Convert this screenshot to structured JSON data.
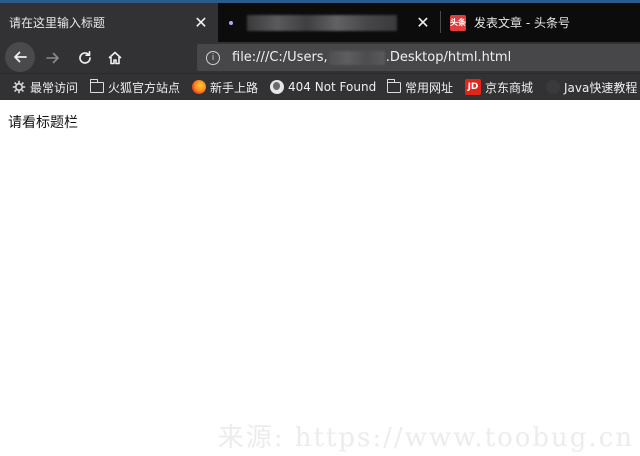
{
  "tabs": [
    {
      "title": "请在这里输入标题",
      "active": true
    },
    {
      "title": "",
      "active": false
    },
    {
      "title": "发表文章 - 头条号",
      "active": false
    }
  ],
  "toolbar": {
    "url_prefix": "file:///C:/Users,",
    "url_suffix": ".Desktop/html.html"
  },
  "bookmarks": [
    {
      "label": "最常访问",
      "icon": "gear-icon"
    },
    {
      "label": "火狐官方站点",
      "icon": "folder-icon"
    },
    {
      "label": "新手上路",
      "icon": "firefox-icon"
    },
    {
      "label": "404 Not Found",
      "icon": "globe-icon"
    },
    {
      "label": "常用网址",
      "icon": "folder-icon"
    },
    {
      "label": "京东商城",
      "icon": "jd-icon"
    },
    {
      "label": "Java快速教程 -",
      "icon": "java-icon"
    }
  ],
  "favicons": {
    "toutiao": "头条",
    "jd": "JD"
  },
  "page": {
    "body_text": "请看标题栏",
    "watermark": "来源: https://www.toobug.cn"
  },
  "colors": {
    "chrome_dark": "#0c0c0d",
    "toolbar": "#323234",
    "active_tab": "#323234",
    "url_bar": "#474749",
    "accent": "#2c5a8c"
  }
}
